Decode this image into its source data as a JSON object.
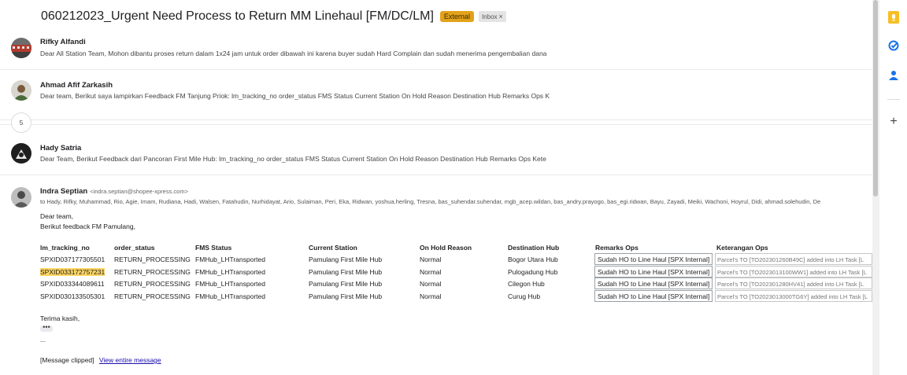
{
  "subject": {
    "title": "060212023_Urgent Need Process to Return MM Linehaul [FM/DC/LM]",
    "badge_external": "External",
    "badge_inbox": "Inbox",
    "badge_inbox_remove": "×"
  },
  "messages": [
    {
      "sender": "Rifky Alfandi",
      "snippet": "Dear All Station Team, Mohon dibantu proses return dalam 1x24 jam untuk order dibawah ini karena buyer sudah Hard Complain dan sudah menerima pengembalian dana"
    },
    {
      "sender": "Ahmad Afif Zarkasih",
      "snippet": "Dear team, Berikut saya lampirkan Feedback FM Tanjung Priok: lm_tracking_no order_status FMS Status Current Station On Hold Reason Destination Hub Remarks Ops K"
    },
    {
      "sender": "Hady Satria",
      "snippet": "Dear Team, Berikut Feedback dari Pancoran First Mile Hub: lm_tracking_no order_status FMS Status Current Station On Hold Reason Destination Hub Remarks Ops Kete"
    }
  ],
  "collapsed_count": "5",
  "open_message": {
    "sender": "Indra Septian",
    "email": "<indra.septian@shopee-xpress.com>",
    "recipients": "to Hady, Rifky, Muhammad, Rio, Agie, Imam, Rudiana, Hadi, Walsen, Fatahudin, Nurhidayat, Ario, Sulaiman, Peri, Eka, Ridwan, yoshua.herling, Tresna, bas_suhendar.suhendar, mgb_acep.wildan, bas_andry.prayogo, bas_egi.ridwan, Bayu, Zayadi, Meiki, Wachoni, Hoyrul, Didi, ahmad.solehudin, De",
    "greeting": "Dear team,",
    "intro": "Berikut feedback FM Pamulang,",
    "table": {
      "headers": [
        "lm_tracking_no",
        "order_status",
        "FMS Status",
        "Current Station",
        "On Hold Reason",
        "Destination Hub",
        "Remarks Ops",
        "Keterangan Ops"
      ],
      "rows": [
        [
          "SPXID037177305501",
          "RETURN_PROCESSING",
          "FMHub_LHTransported",
          "Pamulang First Mile Hub",
          "Normal",
          "Bogor Utara Hub",
          "Sudah HO to Line Haul [SPX Internal]",
          "Parcel's TO [TO202301260B49C] added into LH Task [L"
        ],
        [
          "SPXID033172757231",
          "RETURN_PROCESSING",
          "FMHub_LHTransported",
          "Pamulang First Mile Hub",
          "Normal",
          "Pulogadung Hub",
          "Sudah HO to Line Haul [SPX Internal]",
          "Parcel's TO [TO2023013100WW1] added into LH Task [L"
        ],
        [
          "SPXID033344089611",
          "RETURN_PROCESSING",
          "FMHub_LHTransported",
          "Pamulang First Mile Hub",
          "Normal",
          "Cilegon Hub",
          "Sudah HO to Line Haul [SPX Internal]",
          "Parcel's TO [TO202301280HV41] added into LH Task [L"
        ],
        [
          "SPXID030133505301",
          "RETURN_PROCESSING",
          "FMHub_LHTransported",
          "Pamulang First Mile Hub",
          "Normal",
          "Curug Hub",
          "Sudah HO to Line Haul [SPX Internal]",
          "Parcel's TO [TO2023013000TG6Y] added into LH Task [L"
        ]
      ]
    },
    "closing": "Terima kasih,",
    "dots": "•••",
    "ellipsis": "...",
    "clipped_text": "[Message clipped]",
    "view_entire": "View entire message"
  },
  "side_panel": {
    "icons": [
      "keep-icon",
      "tasks-icon",
      "contacts-icon",
      "add-icon"
    ],
    "add_symbol": "+"
  },
  "colors": {
    "external_badge": "#e3a21a",
    "highlight": "#fdd663",
    "link": "#1a0dab",
    "keep": "#f6bf26",
    "tasks": "#1a73e8",
    "contacts": "#1a73e8"
  }
}
